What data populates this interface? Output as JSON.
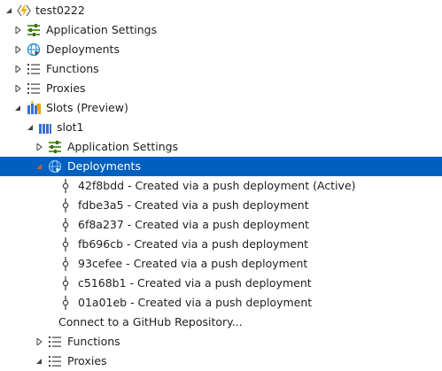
{
  "tree": {
    "root_label": "test0222",
    "app_settings": "Application Settings",
    "deployments": "Deployments",
    "functions": "Functions",
    "proxies": "Proxies",
    "slots": "Slots (Preview)",
    "slot1": "slot1",
    "slot_app_settings": "Application Settings",
    "slot_deployments": "Deployments",
    "commits": [
      "42f8bdd - Created via a push deployment (Active)",
      "fdbe3a5 - Created via a push deployment",
      "6f8a237 - Created via a push deployment",
      "fb696cb - Created via a push deployment",
      "93cefee - Created via a push deployment",
      "c5168b1 - Created via a push deployment",
      "01a01eb - Created via a push deployment"
    ],
    "connect_github": "Connect to a GitHub Repository...",
    "slot_functions": "Functions",
    "slot_proxies": "Proxies"
  },
  "colors": {
    "selection": "#0060c0",
    "function_app_icon": "#f0b400",
    "settings_icon": "#5c9d2c",
    "globe_icon": "#1e8fd6",
    "slots_icon": "#3b6fd6",
    "text": "#1e1e1e"
  }
}
